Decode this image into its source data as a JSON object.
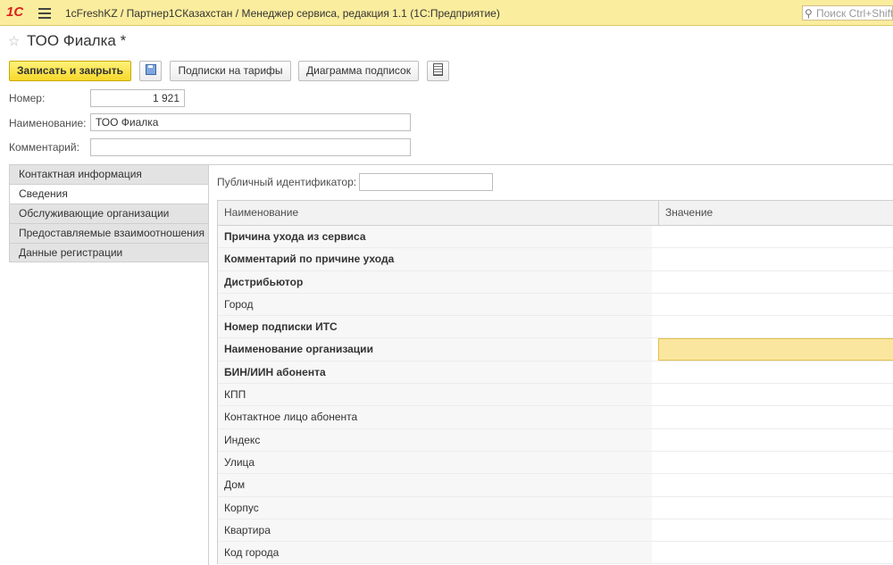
{
  "topbar": {
    "logo": "1С",
    "title": "1cFreshKZ / Партнер1СКазахстан / Менеджер сервиса, редакция 1.1  (1С:Предприятие)",
    "search_placeholder": "Поиск Ctrl+Shift+F"
  },
  "form": {
    "title": "ТОО Фиалка *"
  },
  "toolbar": {
    "save_close": "Записать и закрыть",
    "subscriptions": "Подписки на тарифы",
    "diagram": "Диаграмма подписок"
  },
  "fields": {
    "number_label": "Номер:",
    "number_value": "1 921",
    "name_label": "Наименование:",
    "name_value": "ТОО Фиалка",
    "comment_label": "Комментарий:",
    "comment_value": ""
  },
  "tabs": [
    {
      "label": "Контактная информация"
    },
    {
      "label": "Сведения"
    },
    {
      "label": "Обслуживающие организации"
    },
    {
      "label": "Предоставляемые взаимоотношения"
    },
    {
      "label": "Данные регистрации"
    }
  ],
  "details": {
    "public_id_label": "Публичный идентификатор:",
    "public_id_value": "",
    "columns": [
      "Наименование",
      "Значение"
    ],
    "rows": [
      {
        "name": "Причина ухода из сервиса",
        "value": ""
      },
      {
        "name": "Комментарий по причине ухода",
        "value": ""
      },
      {
        "name": "Дистрибьютор",
        "value": ""
      },
      {
        "name": "Город",
        "value": ""
      },
      {
        "name": "Номер подписки ИТС",
        "value": ""
      },
      {
        "name": "Наименование организации",
        "value": ""
      },
      {
        "name": "БИН/ИИН абонента",
        "value": ""
      },
      {
        "name": "КПП",
        "value": ""
      },
      {
        "name": "Контактное лицо абонента",
        "value": ""
      },
      {
        "name": "Индекс",
        "value": ""
      },
      {
        "name": "Улица",
        "value": ""
      },
      {
        "name": "Дом",
        "value": ""
      },
      {
        "name": "Корпус",
        "value": ""
      },
      {
        "name": "Квартира",
        "value": ""
      },
      {
        "name": "Код города",
        "value": ""
      }
    ]
  }
}
